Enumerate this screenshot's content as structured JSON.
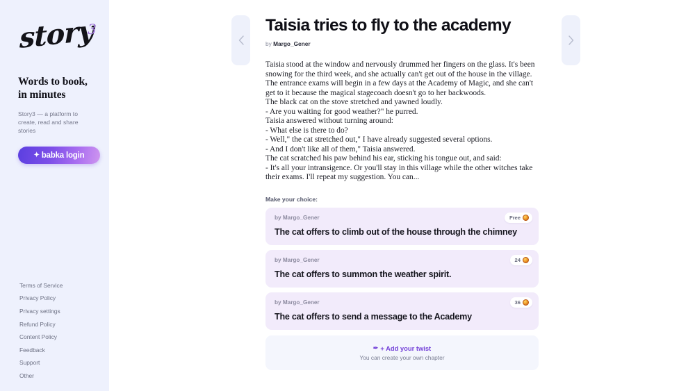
{
  "sidebar": {
    "logo": {
      "word": "story",
      "superscript": "3",
      "name": "story3-logo"
    },
    "tagline_line1": "Words to book,",
    "tagline_line2": "in minutes",
    "subtagline": "Story3 — a platform to create, read and share stories",
    "login_button": {
      "label": "babka login",
      "icon": "✦",
      "gradient_from": "#5b3fe0",
      "gradient_to": "#cf96ef"
    },
    "footer_links": [
      "Terms of Service",
      "Privacy Policy",
      "Privacy settings",
      "Refund Policy",
      "Content Policy",
      "Feedback",
      "Support",
      "Other"
    ],
    "background": "#eef1fd"
  },
  "nav": {
    "prev_label": "‹",
    "next_label": "›"
  },
  "story": {
    "title": "Taisia tries to fly to the academy",
    "by_prefix": "by",
    "author": "Margo_Gener",
    "body": "Taisia stood at the window and nervously drummed her fingers on the glass. It's been snowing for the third week, and she actually can't get out of the house in the village. The entrance exams will begin in a few days at the Academy of Magic, and she can't get to it because the magical stagecoach doesn't go to her backwoods.\nThe black cat on the stove stretched and yawned loudly.\n- Are you waiting for good weather?\" he purred.\nTaisia answered without turning around:\n- What else is there to do?\n- Well,\" the cat stretched out,\" I have already suggested several options.\n- And I don't like all of them,\" Taisia answered.\nThe cat scratched his paw behind his ear, sticking his tongue out, and said:\n- It's all your intransigence. Or you'll stay in this village while the other witches take their exams. I'll repeat my suggestion. You can..."
  },
  "choices": {
    "label": "Make your choice:",
    "items": [
      {
        "author_prefix": "by",
        "author": "Margo_Gener",
        "text": "The cat offers to climb out of the house through the chimney",
        "price": "Free"
      },
      {
        "author_prefix": "by",
        "author": "Margo_Gener",
        "text": "The cat offers to summon the weather spirit.",
        "price": "24"
      },
      {
        "author_prefix": "by",
        "author": "Margo_Gener",
        "text": "The cat offers to send a message to the Academy",
        "price": "36"
      }
    ],
    "card_background": "#f2ebfb"
  },
  "twist": {
    "icon": "✒",
    "title": "+ Add your twist",
    "subtitle": "You can create your own chapter",
    "accent": "#7341d8"
  }
}
